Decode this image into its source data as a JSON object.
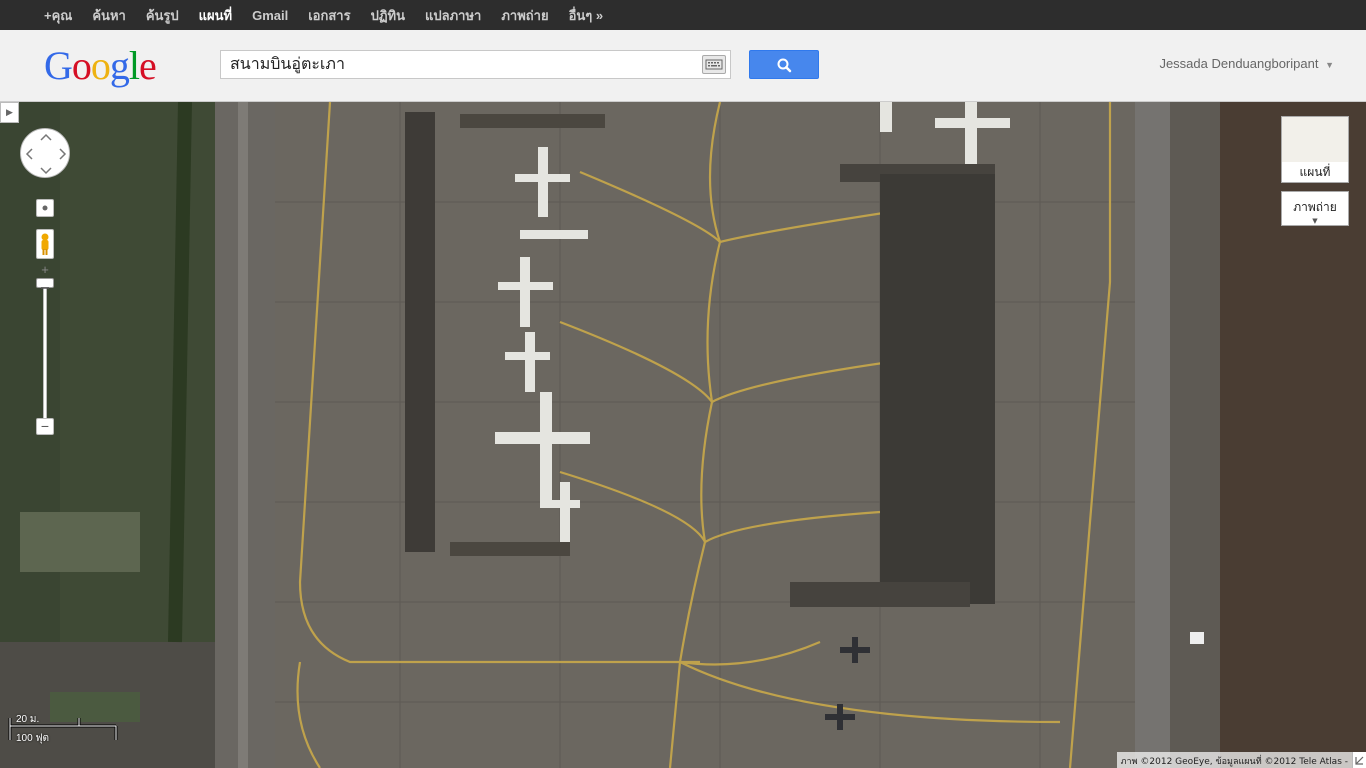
{
  "topbar": {
    "items": [
      {
        "label": "+คุณ",
        "active": false
      },
      {
        "label": "ค้นหา",
        "active": false
      },
      {
        "label": "ค้นรูป",
        "active": false
      },
      {
        "label": "แผนที่",
        "active": true
      },
      {
        "label": "Gmail",
        "active": false
      },
      {
        "label": "เอกสาร",
        "active": false
      },
      {
        "label": "ปฏิทิน",
        "active": false
      },
      {
        "label": "แปลภาษา",
        "active": false
      },
      {
        "label": "ภาพถ่าย",
        "active": false
      },
      {
        "label": "อื่นๆ »",
        "active": false
      }
    ]
  },
  "header": {
    "logo": "Google",
    "search_value": "สนามบินอู่ตะเภา",
    "user_name": "Jessada Denduangboripant",
    "colors": {
      "search_button": "#4787ed",
      "topbar": "#2d2d2d"
    }
  },
  "map": {
    "map_type_map_label": "แผนที่",
    "map_type_satellite_label": "ภาพถ่าย",
    "scale_metric": "20 ม.",
    "scale_imperial": "100 ฟุต",
    "attribution": "ภาพ ©2012 GeoEye, ข้อมูลแผนที่ ©2012 Tele Atlas -"
  }
}
